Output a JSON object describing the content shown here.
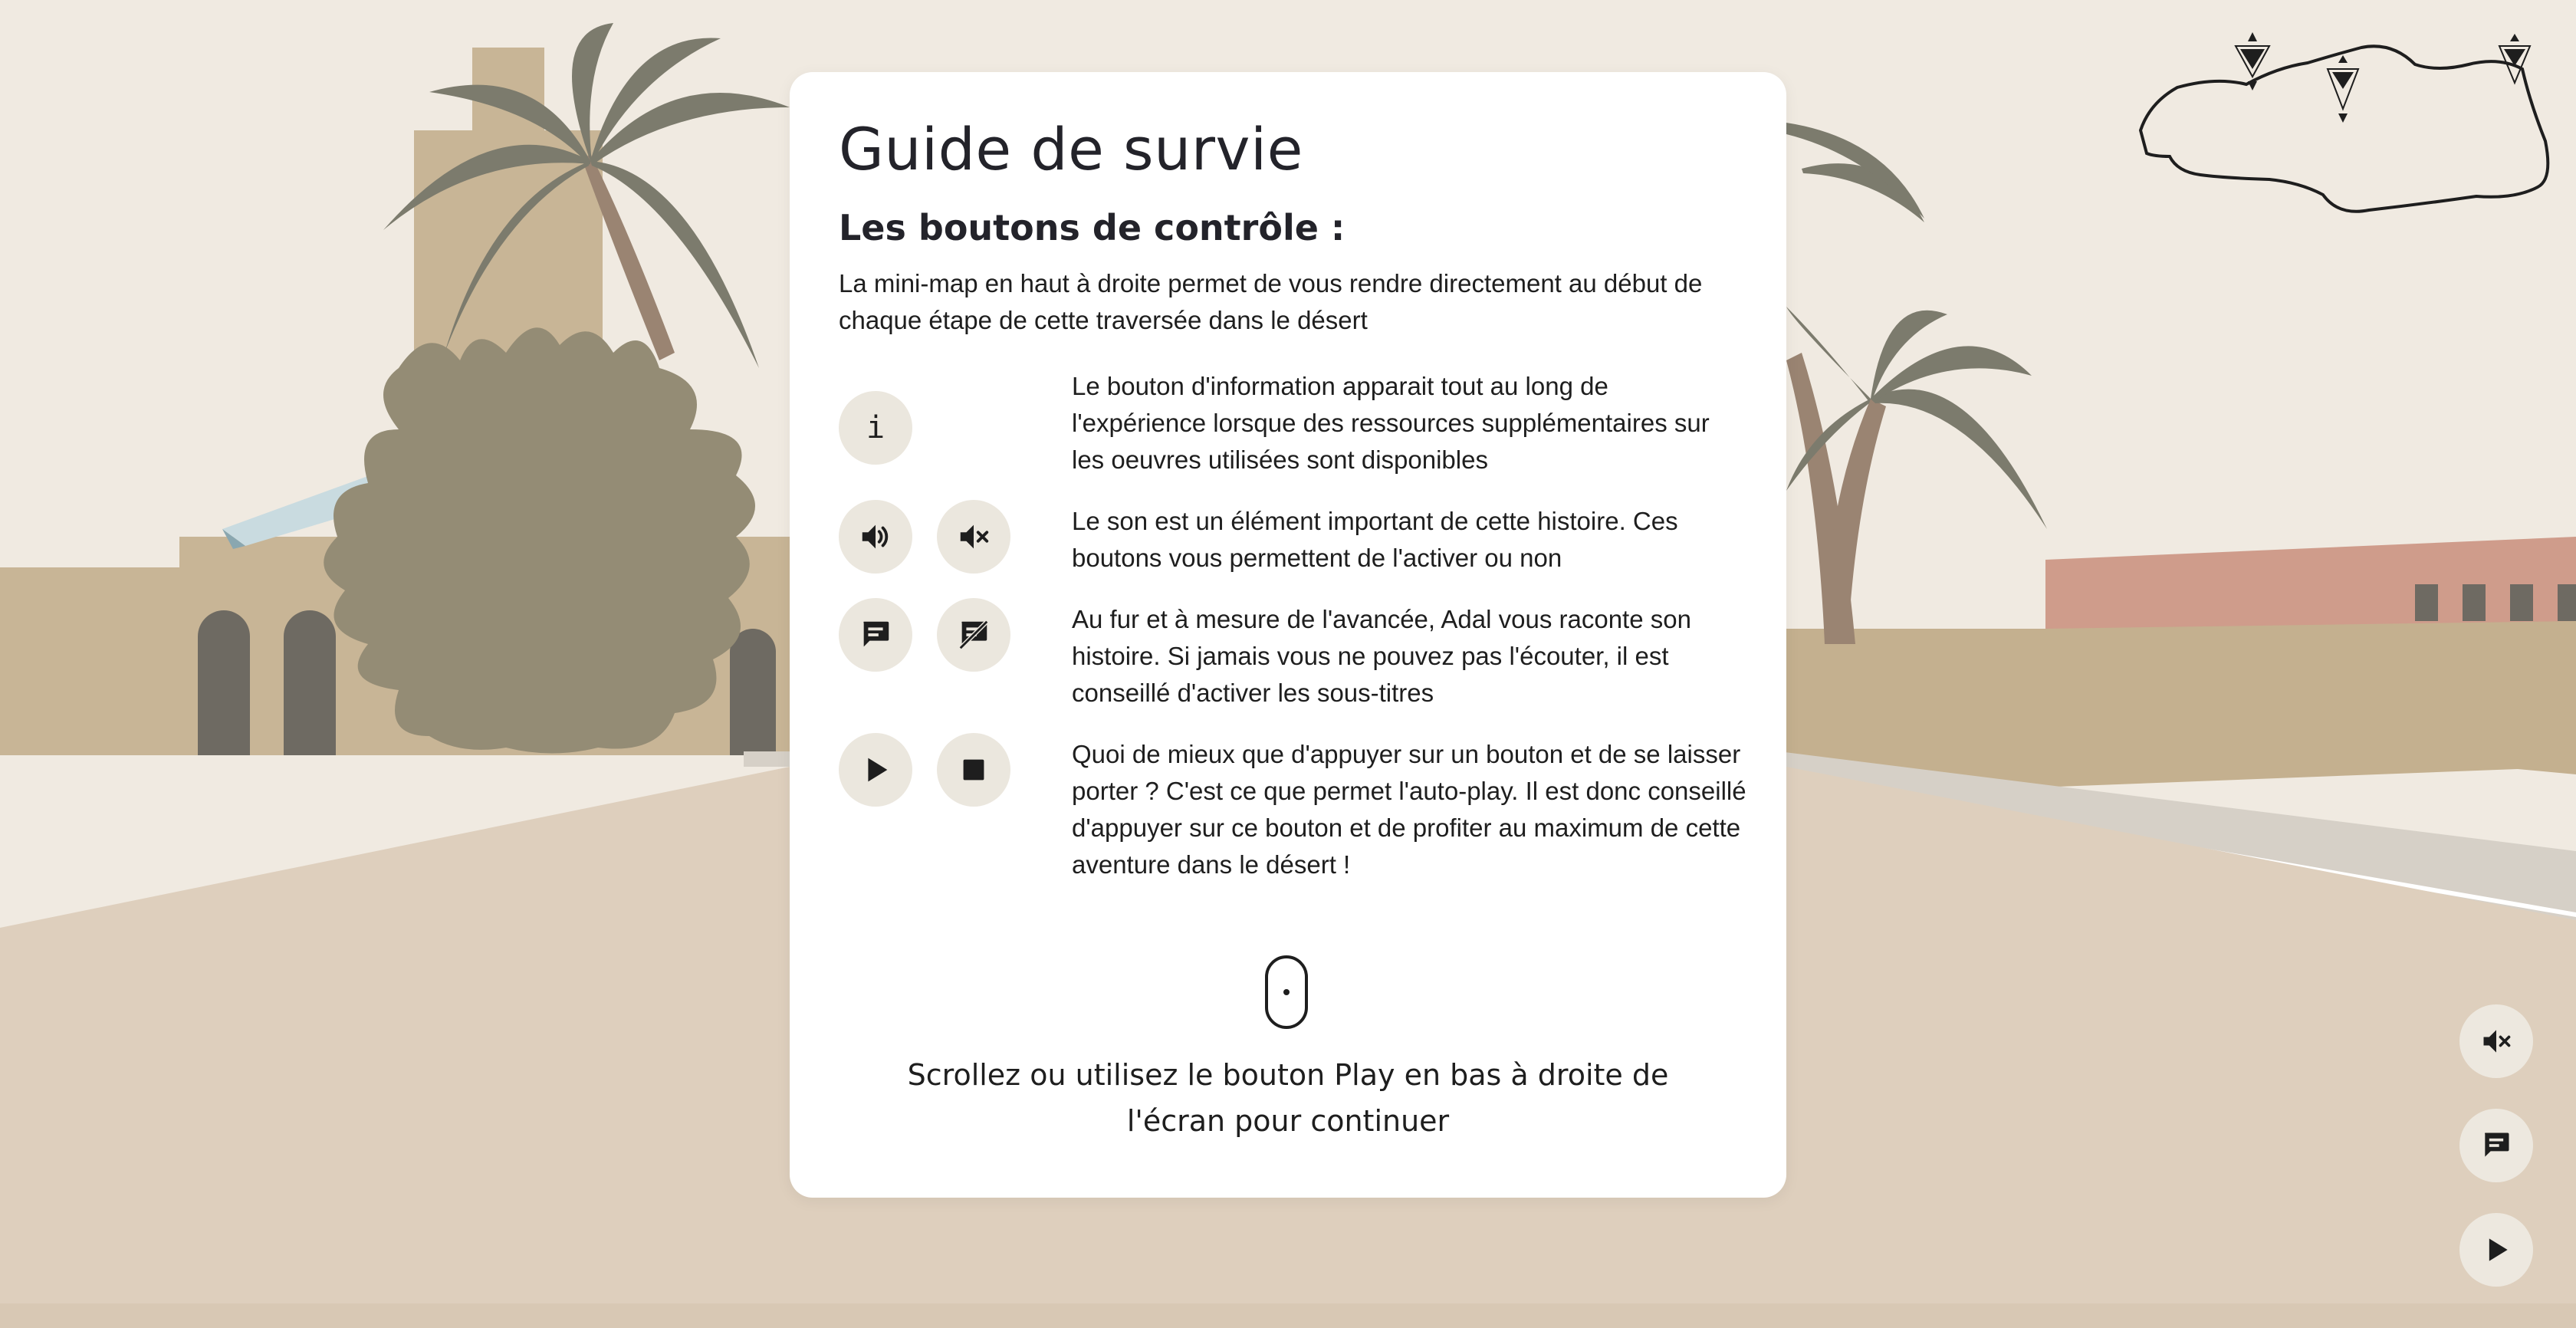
{
  "guide": {
    "title": "Guide de survie",
    "subtitle": "Les boutons de contrôle :",
    "intro": "La mini-map en haut à droite permet de vous rendre directement au début de chaque étape de cette traversée dans le désert",
    "rows": [
      {
        "icons": [
          "info-icon"
        ],
        "text": "Le bouton d'information apparait tout au long de l'expérience lorsque des ressources supplémentaires sur les oeuvres utilisées sont disponibles"
      },
      {
        "icons": [
          "sound-on-icon",
          "sound-off-icon"
        ],
        "text": "Le son est un élément important de cette histoire. Ces boutons vous permettent de l'activer ou non"
      },
      {
        "icons": [
          "subtitles-on-icon",
          "subtitles-off-icon"
        ],
        "text": "Au fur et à mesure de l'avancée, Adal vous raconte son histoire. Si jamais vous ne pouvez pas l'écouter, il est conseillé d'activer les sous-titres"
      },
      {
        "icons": [
          "play-icon",
          "stop-icon"
        ],
        "text": "Quoi de mieux que d'appuyer sur un bouton et de se laisser porter ? C'est ce que permet l'auto-play. Il est donc conseillé d'appuyer sur ce bouton et de profiter au maximum de cette aventure dans le désert !"
      }
    ],
    "info_glyph": "i",
    "scroll_hint": "Scrollez ou utilisez le bouton Play en bas à droite de l'écran pour continuer"
  },
  "floating_controls": [
    "sound-off-icon",
    "subtitles-icon",
    "play-icon"
  ],
  "colors": {
    "sky": "#f0eae1",
    "ground": "#decfbd",
    "wall": "#c8b596",
    "palm": "#7c7b6d",
    "bush": "#948c75",
    "pink_building": "#cf9c8b",
    "button_bg": "#ebe7de",
    "text": "#1e1e1e"
  }
}
